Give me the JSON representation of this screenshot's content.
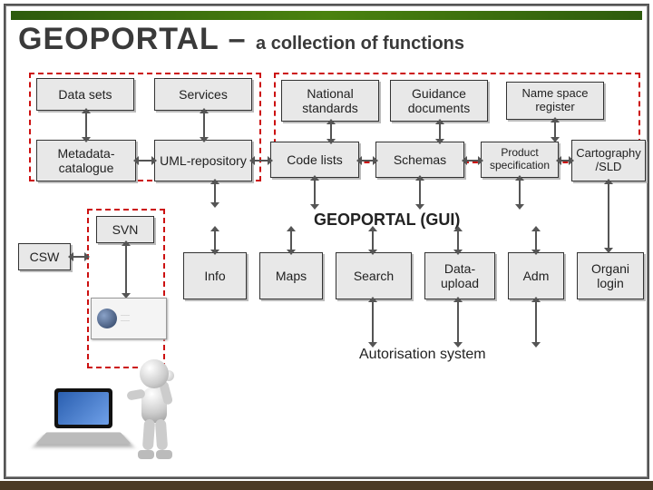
{
  "title_main": "GEOPORTAL –",
  "title_sub": "a collection of functions",
  "row1": {
    "data_sets": "Data sets",
    "services": "Services",
    "national_standards": "National standards",
    "guidance_documents": "Guidance documents",
    "namespace_register": "Name space register"
  },
  "row2": {
    "metadata_catalogue": "Metadata-catalogue",
    "uml_repository": "UML-repository",
    "code_lists": "Code lists",
    "schemas": "Schemas",
    "product_specification": "Product specification",
    "cartography_sld": "Cartography /SLD"
  },
  "svn": "SVN",
  "csw": "CSW",
  "gui_title": "GEOPORTAL (GUI)",
  "gui": {
    "info": "Info",
    "maps": "Maps",
    "search": "Search",
    "data_upload": "Data-upload",
    "adm": "Adm",
    "organi_login": "Organi login"
  },
  "auth": "Autorisation system"
}
